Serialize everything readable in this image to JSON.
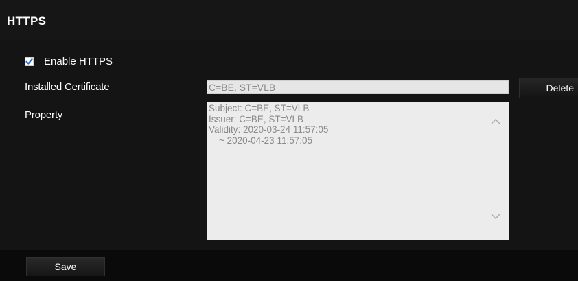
{
  "section": {
    "title": "HTTPS"
  },
  "enable_https": {
    "label": "Enable HTTPS",
    "checked": true,
    "check_color": "#2a6fdb"
  },
  "installed_certificate": {
    "label": "Installed Certificate",
    "value": "C=BE, ST=VLB",
    "delete_label": "Delete"
  },
  "property": {
    "label": "Property",
    "lines": [
      "Subject: C=BE, ST=VLB",
      "Issuer: C=BE, ST=VLB",
      "Validity: 2020-03-24 11:57:05",
      "    ~ 2020-04-23 11:57:05"
    ],
    "scroll_up_icon": "chevron-up-icon",
    "scroll_down_icon": "chevron-down-icon"
  },
  "footer": {
    "save_label": "Save"
  }
}
